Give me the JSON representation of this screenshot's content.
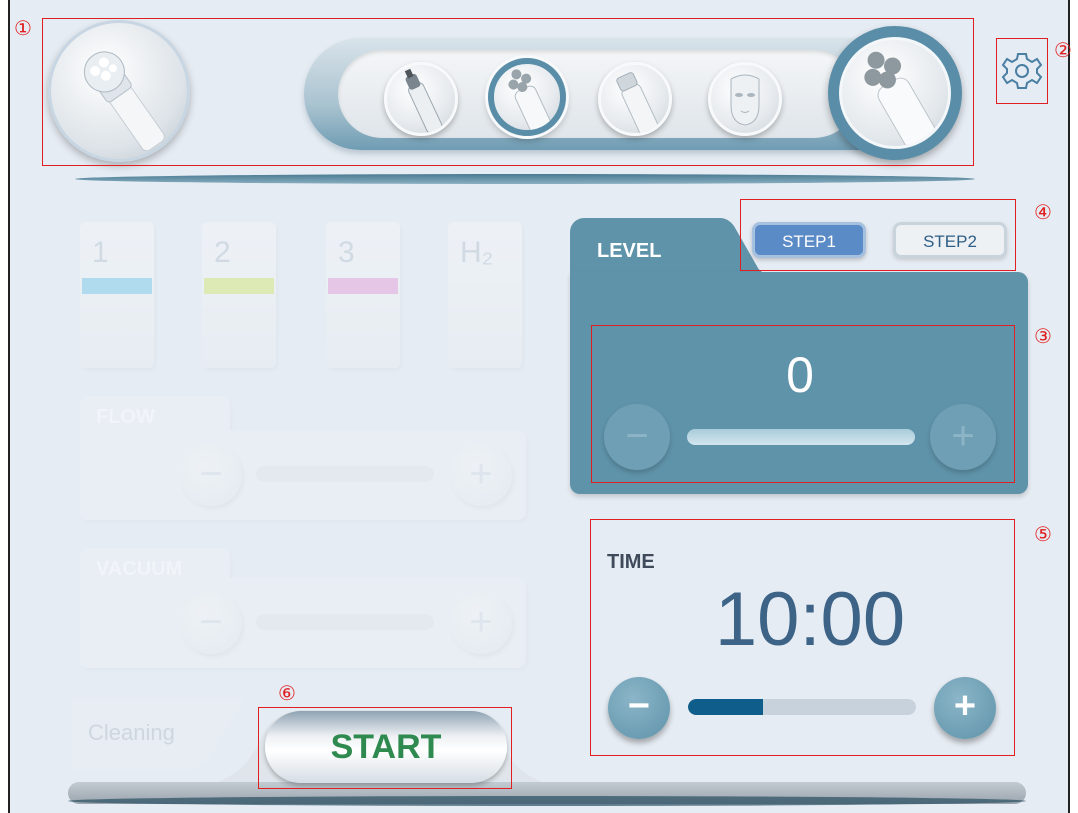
{
  "markers": {
    "m1": "①",
    "m2": "②",
    "m3": "③",
    "m4": "④",
    "m5": "⑤",
    "m6": "⑥"
  },
  "handpieces": {
    "left": "crystal-head-handpiece",
    "strip": [
      "nozzle-handpiece",
      "roller-ball-handpiece",
      "wand-handpiece",
      "face-mask-handpiece"
    ],
    "selected": "roller-ball-handpiece",
    "large_selected": "roller-ball-handpiece"
  },
  "channels": [
    {
      "label": "1",
      "color": "#6fc6ea"
    },
    {
      "label": "2",
      "color": "#d6e96b"
    },
    {
      "label": "3",
      "color": "#e79ad9"
    },
    {
      "label": "H₂",
      "color": ""
    }
  ],
  "flow": {
    "title": "FLOW",
    "minus": "−",
    "plus": "+"
  },
  "vacuum": {
    "title": "VACUUM",
    "minus": "−",
    "plus": "+"
  },
  "level": {
    "title": "LEVEL",
    "value": "0",
    "minus": "−",
    "plus": "+"
  },
  "steps": {
    "step1": "STEP1",
    "step2": "STEP2",
    "active": "STEP1"
  },
  "time": {
    "title": "TIME",
    "value": "10:00",
    "minus": "−",
    "plus": "+",
    "progress": 0.33
  },
  "cleaning": {
    "label": "Cleaning"
  },
  "start": {
    "label": "START"
  },
  "colors": {
    "accent": "#5f93a9",
    "start_text": "#2f8a4f",
    "time_text": "#3d6387",
    "annotation": "#e02020"
  }
}
